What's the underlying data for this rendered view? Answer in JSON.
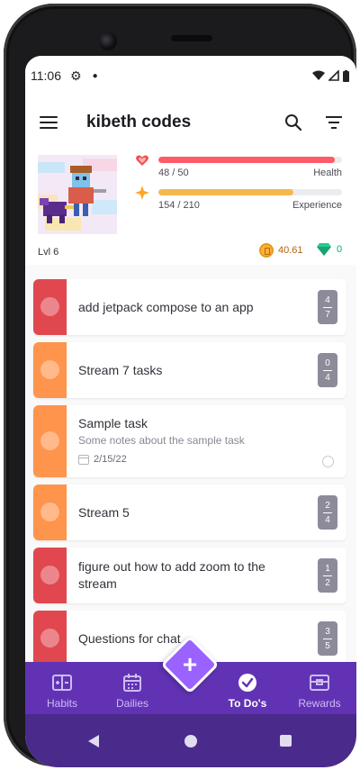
{
  "status_bar": {
    "time": "11:06"
  },
  "app_bar": {
    "title": "kibeth codes"
  },
  "header": {
    "level": "Lvl 6",
    "health": {
      "value_text": "48 / 50",
      "label": "Health",
      "fraction": 0.96,
      "color": "#ff5a68"
    },
    "experience": {
      "value_text": "154 / 210",
      "label": "Experience",
      "fraction": 0.733,
      "color": "#f6b84b"
    },
    "gold": "40.61",
    "gems": "0"
  },
  "tasks": [
    {
      "text": "add jetpack compose to an app",
      "strip_color": "#e0474f",
      "badge_num": "4",
      "badge_den": "7"
    },
    {
      "text": "Stream 7 tasks",
      "strip_color": "#ff944c",
      "badge_num": "0",
      "badge_den": "4"
    },
    {
      "text": "Sample task",
      "notes": "Some notes about the sample task",
      "date": "2/15/22",
      "strip_color": "#ff944c"
    },
    {
      "text": "Stream 5",
      "strip_color": "#ff944c",
      "badge_num": "2",
      "badge_den": "4"
    },
    {
      "text": "figure out how to add zoom to the stream",
      "strip_color": "#e0474f",
      "badge_num": "1",
      "badge_den": "2"
    },
    {
      "text": "Questions for chat",
      "strip_color": "#e0474f",
      "badge_num": "3",
      "badge_den": "5"
    }
  ],
  "bottom_nav": {
    "habits": "Habits",
    "dailies": "Dailies",
    "todos": "To Do's",
    "rewards": "Rewards",
    "active": "todos"
  },
  "fab": {
    "symbol": "+"
  }
}
